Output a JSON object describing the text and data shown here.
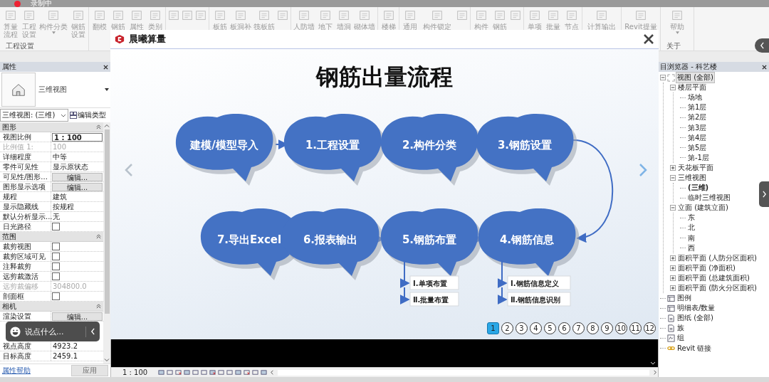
{
  "recording": "录制中",
  "ribbon": [
    {
      "group": "工程设置",
      "items": [
        {
          "label": "算量流程",
          "kind": "button"
        },
        {
          "label": "工程设置",
          "kind": "button"
        },
        {
          "label": "构件分类",
          "kind": "dropdown"
        },
        {
          "label": "钢筋设置",
          "kind": "button"
        }
      ]
    },
    {
      "items": [
        {
          "label": "翻模",
          "kind": "button"
        },
        {
          "label": "钢筋",
          "kind": "button"
        },
        {
          "label": "属性",
          "kind": "button"
        },
        {
          "label": "类别",
          "kind": "button"
        }
      ]
    },
    {
      "items": [
        {
          "kind": "small"
        },
        {
          "kind": "small"
        },
        {
          "kind": "small"
        }
      ]
    },
    {
      "items": [
        {
          "label": "板筋",
          "kind": "button"
        },
        {
          "label": "板洞补",
          "kind": "medium"
        },
        {
          "label": "筏板筋",
          "kind": "medium"
        },
        {
          "kind": "small"
        }
      ]
    },
    {
      "items": [
        {
          "label": "人防墙",
          "kind": "medium"
        },
        {
          "label": "地下",
          "kind": "button"
        },
        {
          "label": "墙洞",
          "kind": "button"
        },
        {
          "label": "砌体墙",
          "kind": "medium"
        }
      ]
    },
    {
      "items": [
        {
          "label": "楼梯",
          "kind": "button"
        }
      ]
    },
    {
      "items": [
        {
          "label": "通用",
          "kind": "button"
        },
        {
          "label": "构件锁定",
          "kind": "wide"
        },
        {
          "kind": "small"
        }
      ]
    },
    {
      "items": [
        {
          "label": "构件",
          "kind": "button"
        },
        {
          "label": "钢筋",
          "kind": "button"
        },
        {
          "kind": "small"
        }
      ]
    },
    {
      "items": [
        {
          "label": "单项",
          "kind": "button"
        },
        {
          "label": "批量",
          "kind": "button"
        },
        {
          "label": "节点",
          "kind": "button"
        }
      ]
    },
    {
      "items": [
        {
          "label": "计算输出",
          "kind": "wide"
        }
      ]
    },
    {
      "items": [
        {
          "label": "Revit提量",
          "kind": "wide"
        }
      ]
    },
    {
      "group": "关于",
      "items": [
        {
          "label": "帮助",
          "kind": "dropdown"
        }
      ]
    }
  ],
  "properties": {
    "title": "属性",
    "type_name": "三维视图",
    "view_selector": "三维视图: (三维)",
    "edit_type": "编辑类型",
    "sections": [
      {
        "name": "图形",
        "rows": [
          {
            "label": "视图比例",
            "kind": "input",
            "value": "1 : 100",
            "disabled": false
          },
          {
            "label": "比例值 1:",
            "kind": "text",
            "value": "100",
            "disabled": true
          },
          {
            "label": "详细程度",
            "kind": "text",
            "value": "中等",
            "disabled": false
          },
          {
            "label": "零件可见性",
            "kind": "text",
            "value": "显示原状态",
            "disabled": false
          },
          {
            "label": "可见性/图形...",
            "kind": "button",
            "value": "编辑...",
            "disabled": false
          },
          {
            "label": "图形显示选项",
            "kind": "button",
            "value": "编辑...",
            "disabled": false
          },
          {
            "label": "规程",
            "kind": "text",
            "value": "建筑",
            "disabled": false
          },
          {
            "label": "显示隐藏线",
            "kind": "text",
            "value": "按规程",
            "disabled": false
          },
          {
            "label": "默认分析显示...",
            "kind": "text",
            "value": "无",
            "disabled": false
          },
          {
            "label": "日光路径",
            "kind": "checkbox",
            "checked": false,
            "disabled": false
          }
        ]
      },
      {
        "name": "范围",
        "rows": [
          {
            "label": "裁剪视图",
            "kind": "checkbox",
            "checked": false,
            "disabled": false
          },
          {
            "label": "裁剪区域可见",
            "kind": "checkbox",
            "checked": false,
            "disabled": false
          },
          {
            "label": "注释裁剪",
            "kind": "checkbox",
            "checked": false,
            "disabled": false
          },
          {
            "label": "远剪裁激活",
            "kind": "checkbox",
            "checked": false,
            "disabled": false
          },
          {
            "label": "远剪裁偏移",
            "kind": "text",
            "value": "304800.0",
            "disabled": true
          },
          {
            "label": "剖面框",
            "kind": "checkbox",
            "checked": false,
            "disabled": false
          }
        ]
      },
      {
        "name": "相机",
        "rows": [
          {
            "label": "渲染设置",
            "kind": "button",
            "value": "编辑...",
            "disabled": false
          },
          {
            "label": "视点高度",
            "kind": "text",
            "value": "4923.2",
            "disabled": false
          },
          {
            "label": "目标高度",
            "kind": "text",
            "value": "2459.1",
            "disabled": false
          }
        ]
      }
    ],
    "help": "属性帮助",
    "apply": "应用"
  },
  "chat_widget": {
    "placeholder": "说点什么..."
  },
  "dialog": {
    "title": "晨曦算量",
    "slide": {
      "title": "钢筋出量流程",
      "steps": [
        {
          "label": "建模/模型导入"
        },
        {
          "label": "1.工程设置"
        },
        {
          "label": "2.构件分类"
        },
        {
          "label": "3.钢筋设置"
        },
        {
          "label": "7.导出Excel"
        },
        {
          "label": "6.报表输出"
        },
        {
          "label": "5.钢筋布置",
          "substeps": [
            "Ⅰ.单项布置",
            "Ⅱ.批量布置"
          ]
        },
        {
          "label": "4.钢筋信息",
          "substeps": [
            "Ⅰ.钢筋信息定义",
            "Ⅱ.钢筋信息识别"
          ]
        }
      ]
    },
    "pages": [
      {
        "label": "1",
        "selected": true
      },
      {
        "label": "2",
        "selected": false
      },
      {
        "label": "3",
        "selected": false
      },
      {
        "label": "4",
        "selected": false
      },
      {
        "label": "5",
        "selected": false
      },
      {
        "label": "6",
        "selected": false
      },
      {
        "label": "7",
        "selected": false
      },
      {
        "label": "8",
        "selected": false
      },
      {
        "label": "9",
        "selected": false
      },
      {
        "label": "10",
        "selected": false
      },
      {
        "label": "11",
        "selected": false
      },
      {
        "label": "12",
        "selected": false
      }
    ]
  },
  "view_bar": {
    "scale": "1 : 100"
  },
  "browser": {
    "title": "目浏览器 - 科艺楼",
    "tree": [
      {
        "label": "视图 (全部)",
        "kind": "views",
        "selected": true,
        "active": false,
        "expanded": true,
        "children": [
          {
            "label": "楼层平面",
            "selected": false,
            "active": false,
            "expanded": true,
            "children": [
              {
                "label": "场地",
                "selected": false,
                "active": false
              },
              {
                "label": "第1层",
                "selected": false,
                "active": false
              },
              {
                "label": "第2层",
                "selected": false,
                "active": false
              },
              {
                "label": "第3层",
                "selected": false,
                "active": false
              },
              {
                "label": "第4层",
                "selected": false,
                "active": false
              },
              {
                "label": "第5层",
                "selected": false,
                "active": false
              },
              {
                "label": "第-1层",
                "selected": false,
                "active": false
              }
            ]
          },
          {
            "label": "天花板平面",
            "selected": false,
            "active": false,
            "expanded": false
          },
          {
            "label": "三维视图",
            "selected": false,
            "active": false,
            "expanded": true,
            "children": [
              {
                "label": "(三维)",
                "selected": false,
                "active": true
              },
              {
                "label": "临时三维视图",
                "selected": false,
                "active": false
              }
            ]
          },
          {
            "label": "立面 (建筑立面)",
            "selected": false,
            "active": false,
            "expanded": true,
            "children": [
              {
                "label": "东",
                "selected": false,
                "active": false
              },
              {
                "label": "北",
                "selected": false,
                "active": false
              },
              {
                "label": "南",
                "selected": false,
                "active": false
              },
              {
                "label": "西",
                "selected": false,
                "active": false
              }
            ]
          },
          {
            "label": "面积平面 (人防分区面积)",
            "selected": false,
            "active": false,
            "expanded": false
          },
          {
            "label": "面积平面 (净面积)",
            "selected": false,
            "active": false,
            "expanded": false
          },
          {
            "label": "面积平面 (总建筑面积)",
            "selected": false,
            "active": false,
            "expanded": false
          },
          {
            "label": "面积平面 (防火分区面积)",
            "selected": false,
            "active": false,
            "expanded": false
          }
        ]
      },
      {
        "label": "图例",
        "kind": "legend",
        "selected": false,
        "active": false
      },
      {
        "label": "明细表/数量",
        "kind": "schedule",
        "selected": false,
        "active": false
      },
      {
        "label": "图纸 (全部)",
        "kind": "sheet",
        "selected": false,
        "active": false
      },
      {
        "label": "族",
        "kind": "family",
        "selected": false,
        "active": false
      },
      {
        "label": "组",
        "kind": "group",
        "selected": false,
        "active": false
      },
      {
        "label": "Revit 链接",
        "kind": "link",
        "selected": false,
        "active": false
      }
    ]
  }
}
